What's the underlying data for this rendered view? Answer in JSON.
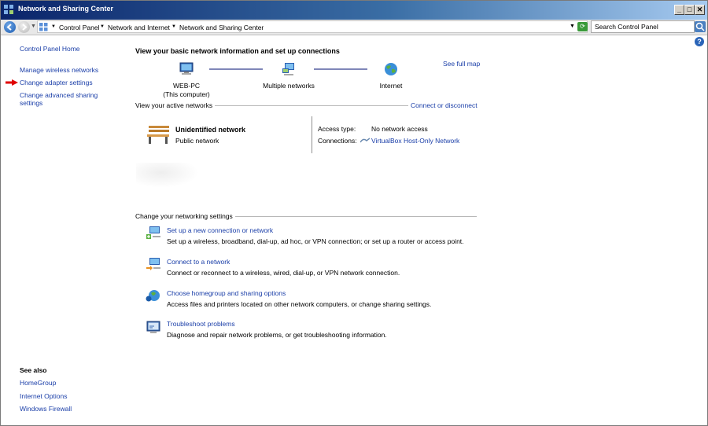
{
  "window": {
    "title": "Network and Sharing Center",
    "controls": {
      "minimize": "_",
      "maximize": "□",
      "close": "✕"
    }
  },
  "address_bar": {
    "breadcrumbs": [
      "Control Panel",
      "Network and Internet",
      "Network and Sharing Center"
    ],
    "search_placeholder": "Search Control Panel"
  },
  "left_pane": {
    "home": "Control Panel Home",
    "links": [
      "Manage wireless networks",
      "Change adapter settings",
      "Change advanced sharing settings"
    ],
    "see_also_title": "See also",
    "see_also_links": [
      "HomeGroup",
      "Internet Options",
      "Windows Firewall"
    ]
  },
  "main": {
    "heading": "View your basic network information and set up connections",
    "see_full_map": "See full map",
    "map_nodes": [
      {
        "label": "WEB-PC",
        "sublabel": "(This computer)",
        "icon": "computer-icon"
      },
      {
        "label": "Multiple networks",
        "icon": "network-icon"
      },
      {
        "label": "Internet",
        "icon": "globe-icon"
      }
    ],
    "active_networks_label": "View your active networks",
    "connect_or_disconnect": "Connect or disconnect",
    "active_network": {
      "name": "Unidentified network",
      "type": "Public network",
      "access_type_label": "Access type:",
      "access_type_value": "No network access",
      "connections_label": "Connections:",
      "connections_value": "VirtualBox Host-Only Network"
    },
    "change_settings_label": "Change your networking settings",
    "tasks": [
      {
        "title": "Set up a new connection or network",
        "desc": "Set up a wireless, broadband, dial-up, ad hoc, or VPN connection; or set up a router or access point."
      },
      {
        "title": "Connect to a network",
        "desc": "Connect or reconnect to a wireless, wired, dial-up, or VPN network connection."
      },
      {
        "title": "Choose homegroup and sharing options",
        "desc": "Access files and printers located on other network computers, or change sharing settings."
      },
      {
        "title": "Troubleshoot problems",
        "desc": "Diagnose and repair network problems, or get troubleshooting information."
      }
    ]
  }
}
